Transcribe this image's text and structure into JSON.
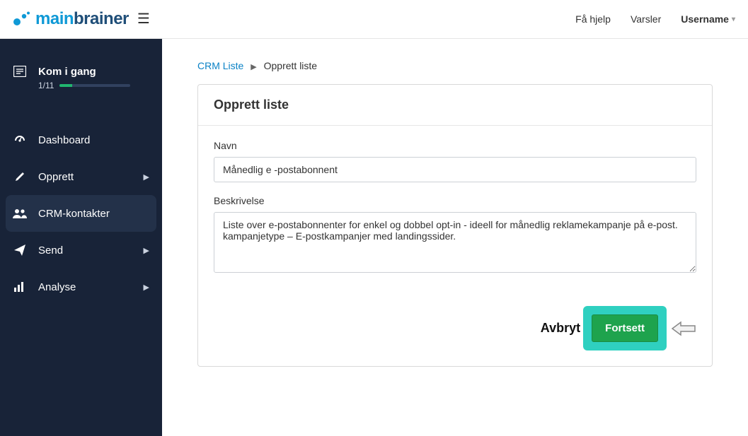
{
  "header": {
    "help": "Få hjelp",
    "alerts": "Varsler",
    "username": "Username"
  },
  "sidebar": {
    "onboard_title": "Kom i gang",
    "onboard_count": "1/11",
    "items": [
      {
        "label": "Dashboard"
      },
      {
        "label": "Opprett"
      },
      {
        "label": "CRM-kontakter"
      },
      {
        "label": "Send"
      },
      {
        "label": "Analyse"
      }
    ]
  },
  "breadcrumb": {
    "root": "CRM Liste",
    "current": "Opprett liste"
  },
  "card": {
    "title": "Opprett liste",
    "name_label": "Navn",
    "name_value": "Månedlig e -postabonnent",
    "desc_label": "Beskrivelse",
    "desc_value": "Liste over e-postabonnenter for enkel og dobbel opt-in - ideell for månedlig reklamekampanje på e-post.\nkampanjetype – E-postkampanjer med landingssider.",
    "cancel": "Avbryt",
    "continue": "Fortsett"
  }
}
